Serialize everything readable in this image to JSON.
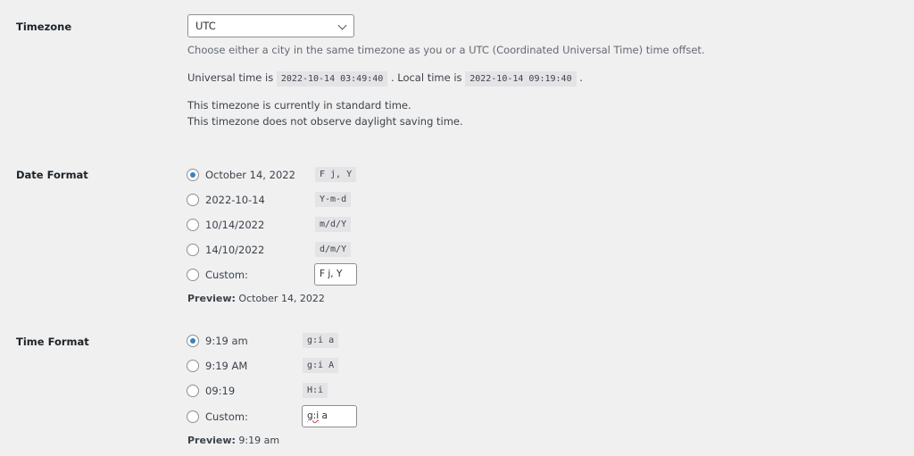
{
  "timezone": {
    "label": "Timezone",
    "selected": "UTC",
    "description": "Choose either a city in the same timezone as you or a UTC (Coordinated Universal Time) time offset.",
    "universal_prefix": "Universal time is",
    "universal_time": "2022-10-14 03:49:40",
    "local_prefix": ". Local time is",
    "local_time": "2022-10-14 09:19:40",
    "local_suffix": ".",
    "status_line1": "This timezone is currently in standard time.",
    "status_line2": "This timezone does not observe daylight saving time."
  },
  "date_format": {
    "label": "Date Format",
    "options": [
      {
        "label": "October 14, 2022",
        "format": "F j, Y",
        "checked": true
      },
      {
        "label": "2022-10-14",
        "format": "Y-m-d",
        "checked": false
      },
      {
        "label": "10/14/2022",
        "format": "m/d/Y",
        "checked": false
      },
      {
        "label": "14/10/2022",
        "format": "d/m/Y",
        "checked": false
      }
    ],
    "custom_label": "Custom:",
    "custom_value": "F j, Y",
    "preview_label": "Preview:",
    "preview_value": "October 14, 2022"
  },
  "time_format": {
    "label": "Time Format",
    "options": [
      {
        "label": "9:19 am",
        "format": "g:i a",
        "checked": true
      },
      {
        "label": "9:19 AM",
        "format": "g:i A",
        "checked": false
      },
      {
        "label": "09:19",
        "format": "H:i",
        "checked": false
      }
    ],
    "custom_label": "Custom:",
    "custom_value_misspelled": "g:i",
    "custom_value_rest": " a",
    "preview_label": "Preview:",
    "preview_value": "9:19 am"
  }
}
